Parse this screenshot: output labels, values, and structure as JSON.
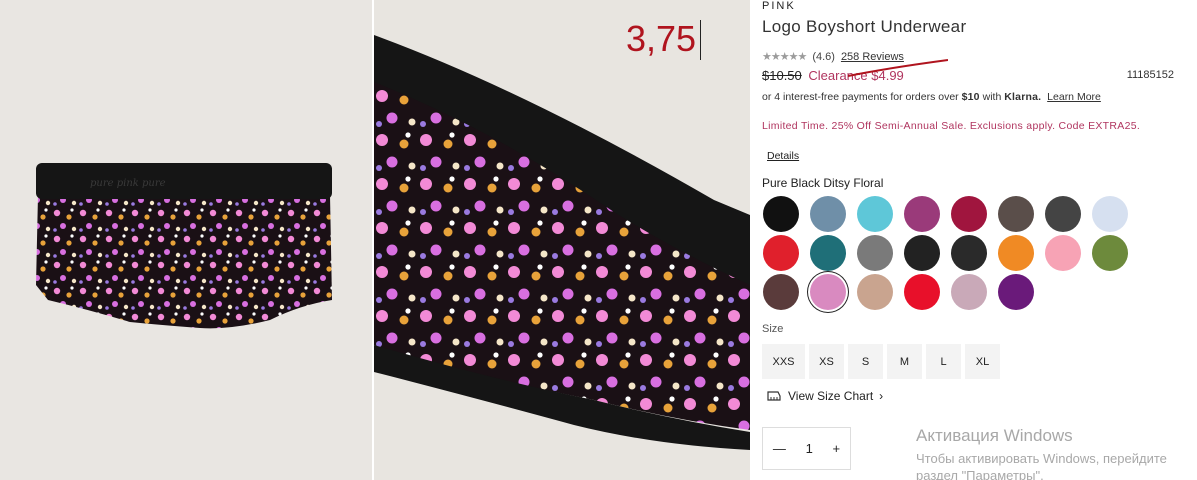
{
  "overlay": {
    "number": "3,75"
  },
  "product": {
    "brand": "PINK",
    "title": "Logo Boyshort Underwear",
    "rating": "(4.6)",
    "reviews": "258 Reviews",
    "old_price": "$10.50",
    "clearance_price": "Clearance $4.99",
    "sku": "11185152",
    "klarna_text": "or 4 interest-free payments for orders over",
    "klarna_amount": "$10",
    "klarna_with": "with",
    "klarna_brand": "Klarna.",
    "klarna_learn": "Learn More",
    "promo": "Limited Time. 25% Off Semi-Annual Sale. Exclusions apply. Code EXTRA25.",
    "details": "Details",
    "color_name": "Pure Black Ditsy Floral"
  },
  "swatches": [
    {
      "color": "#111111"
    },
    {
      "color": "#6f8fa8"
    },
    {
      "color": "#5ec7d8"
    },
    {
      "color": "#9a3a7a"
    },
    {
      "color": "#a0153e"
    },
    {
      "color": "#5a4e4a"
    },
    {
      "color": "#444444"
    },
    {
      "color": "#d6e0f0"
    },
    {
      "color": "#e0202c"
    },
    {
      "color": "#1f6f78"
    },
    {
      "color": "#7a7a7a"
    },
    {
      "color": "#222222"
    },
    {
      "color": "#2a2a2a"
    },
    {
      "color": "#f08a24"
    },
    {
      "color": "#f7a3b5"
    },
    {
      "color": "#6d8a3c"
    },
    {
      "color": "#5a3b3b"
    },
    {
      "color": "#d98ac0"
    },
    {
      "color": "#c9a48f"
    },
    {
      "color": "#e8102a"
    },
    {
      "color": "#c9a9b8"
    },
    {
      "color": "#6a1a7a"
    }
  ],
  "selected_swatch": 17,
  "size": {
    "label": "Size",
    "options": [
      "XXS",
      "XS",
      "S",
      "M",
      "L",
      "XL"
    ],
    "chart_link": "View Size Chart"
  },
  "quantity": {
    "minus": "—",
    "value": "1",
    "plus": "+"
  },
  "windows_watermark": {
    "line1": "Активация Windows",
    "line2": "Чтобы активировать Windows, перейдите",
    "line3": "раздел \"Параметры\"."
  },
  "colors": {
    "accent": "#b0355f",
    "overlay_red": "#b0141e"
  }
}
